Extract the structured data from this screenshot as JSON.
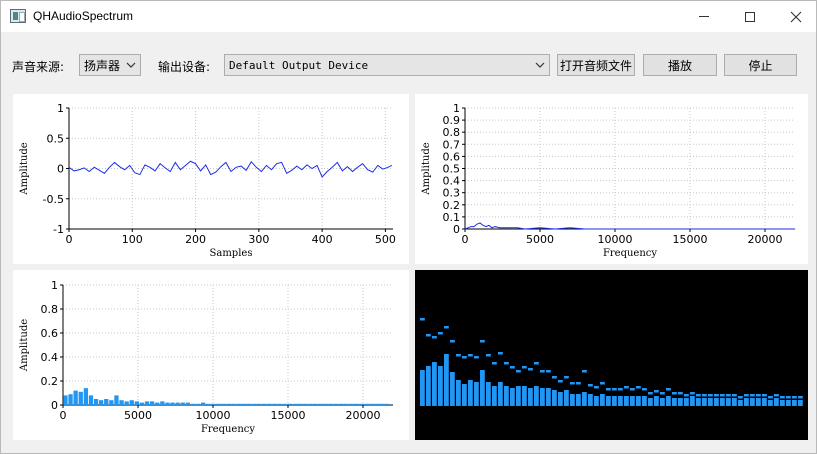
{
  "window": {
    "title": "QHAudioSpectrum",
    "controls": {
      "minimize": "minimize-icon",
      "maximize": "maximize-icon",
      "close": "close-icon"
    }
  },
  "toolbar": {
    "source_label": "声音来源:",
    "source_value": "扬声器",
    "output_label": "输出设备:",
    "output_value": "Default Output Device",
    "open_button": "打开音频文件",
    "play_button": "播放",
    "stop_button": "停止"
  },
  "colors": {
    "waveform": "#1f2ee6",
    "spectrum": "#1f2ee6",
    "bars": "#2196f3",
    "dark_bg": "#000000"
  },
  "chart_data": [
    {
      "type": "line",
      "xlabel": "Samples",
      "ylabel": "Amplitude",
      "xlim": [
        0,
        512
      ],
      "ylim": [
        -1,
        1
      ],
      "xticks": [
        "0",
        "100",
        "200",
        "300",
        "400",
        "500"
      ],
      "yticks": [
        "1",
        "0.5",
        "0",
        "-0.5",
        "-1"
      ],
      "grid": true,
      "x": [
        0,
        8,
        16,
        24,
        32,
        40,
        48,
        56,
        64,
        72,
        80,
        88,
        96,
        104,
        112,
        120,
        128,
        136,
        144,
        152,
        160,
        168,
        176,
        184,
        192,
        200,
        208,
        216,
        224,
        232,
        240,
        248,
        256,
        264,
        272,
        280,
        288,
        296,
        304,
        312,
        320,
        328,
        336,
        344,
        352,
        360,
        368,
        376,
        384,
        392,
        400,
        408,
        416,
        424,
        432,
        440,
        448,
        456,
        464,
        472,
        480,
        488,
        496,
        504,
        510
      ],
      "y": [
        0.02,
        -0.04,
        -0.02,
        0.01,
        -0.05,
        0.02,
        -0.03,
        -0.08,
        0.02,
        0.1,
        0.03,
        -0.02,
        0.05,
        -0.07,
        -0.1,
        0.06,
        0.02,
        -0.04,
        0.08,
        0.01,
        -0.05,
        0.1,
        -0.02,
        0.05,
        0.12,
        0.08,
        -0.04,
        0.06,
        -0.1,
        -0.06,
        0.03,
        0.1,
        -0.05,
        0.02,
        0.04,
        -0.03,
        0.11,
        0.02,
        -0.05,
        0.05,
        -0.02,
        0.08,
        0.1,
        -0.08,
        -0.03,
        0.04,
        -0.02,
        0.06,
        0.0,
        0.05,
        -0.14,
        -0.05,
        0.02,
        0.1,
        -0.04,
        0.03,
        -0.05,
        0.02,
        0.08,
        -0.02,
        -0.06,
        0.05,
        -0.01,
        0.02,
        0.05
      ]
    },
    {
      "type": "line",
      "xlabel": "Frequency",
      "ylabel": "Amplitude",
      "xlim": [
        0,
        22000
      ],
      "ylim": [
        0,
        1
      ],
      "xticks": [
        "0",
        "5000",
        "10000",
        "15000",
        "20000"
      ],
      "yticks": [
        "1",
        "0.9",
        "0.8",
        "0.7",
        "0.6",
        "0.5",
        "0.4",
        "0.3",
        "0.2",
        "0.1",
        "0"
      ],
      "grid": true,
      "x": [
        0,
        200,
        400,
        600,
        800,
        1000,
        1200,
        1400,
        1600,
        1800,
        2000,
        2300,
        2600,
        3000,
        3500,
        4000,
        5000,
        6000,
        7000,
        8000,
        10000,
        12000,
        15000,
        18000,
        22000
      ],
      "y": [
        0.0,
        0.01,
        0.02,
        0.02,
        0.04,
        0.05,
        0.03,
        0.02,
        0.03,
        0.01,
        0.02,
        0.01,
        0.01,
        0.01,
        0.01,
        0.0,
        0.01,
        0.0,
        0.01,
        0.0,
        0.0,
        0.0,
        0.0,
        0.0,
        0.0
      ]
    },
    {
      "type": "bar",
      "xlabel": "Frequency",
      "ylabel": "Amplitude",
      "xlim": [
        0,
        22000
      ],
      "ylim": [
        0,
        1
      ],
      "xticks": [
        "0",
        "5000",
        "10000",
        "15000",
        "20000"
      ],
      "yticks": [
        "1",
        "0.8",
        "0.6",
        "0.4",
        "0.2",
        "0"
      ],
      "grid": true,
      "bar_width": 340,
      "x": [
        170,
        510,
        850,
        1190,
        1530,
        1870,
        2210,
        2550,
        2890,
        3230,
        3570,
        3910,
        4250,
        4590,
        4930,
        5270,
        5610,
        5950,
        6290,
        6630,
        6970,
        7310,
        7650,
        7990,
        8330,
        8670,
        9010,
        9350,
        9690,
        10030,
        10370,
        10710,
        11050,
        11390,
        11730,
        12070,
        12410,
        12750,
        13090,
        13430,
        13770,
        14110,
        14450,
        14790,
        15130,
        15470,
        15810,
        16150,
        16490,
        16830,
        17170,
        17510,
        17850,
        18190,
        18530,
        18870,
        19210,
        19550,
        19890,
        20230,
        20570,
        20910,
        21250,
        21590
      ],
      "values": [
        0.08,
        0.09,
        0.12,
        0.11,
        0.14,
        0.08,
        0.05,
        0.04,
        0.05,
        0.04,
        0.08,
        0.04,
        0.03,
        0.04,
        0.03,
        0.02,
        0.03,
        0.03,
        0.02,
        0.03,
        0.02,
        0.02,
        0.02,
        0.02,
        0.02,
        0.01,
        0.01,
        0.02,
        0.01,
        0.01,
        0.01,
        0.01,
        0.01,
        0.01,
        0.01,
        0.01,
        0.01,
        0.01,
        0.01,
        0.01,
        0.01,
        0.01,
        0.01,
        0.01,
        0.01,
        0.01,
        0.01,
        0.01,
        0.01,
        0.01,
        0.01,
        0.01,
        0.01,
        0.01,
        0.01,
        0.01,
        0.01,
        0.01,
        0.01,
        0.01,
        0.01,
        0.01,
        0.01,
        0.01
      ]
    },
    {
      "type": "bar",
      "ylim": [
        0,
        1
      ],
      "values": [
        0.36,
        0.4,
        0.44,
        0.4,
        0.52,
        0.34,
        0.26,
        0.22,
        0.26,
        0.24,
        0.36,
        0.24,
        0.2,
        0.24,
        0.2,
        0.18,
        0.2,
        0.2,
        0.18,
        0.2,
        0.18,
        0.18,
        0.16,
        0.14,
        0.16,
        0.12,
        0.12,
        0.14,
        0.12,
        0.1,
        0.12,
        0.1,
        0.1,
        0.1,
        0.1,
        0.1,
        0.1,
        0.1,
        0.08,
        0.1,
        0.08,
        0.1,
        0.08,
        0.08,
        0.08,
        0.1,
        0.08,
        0.08,
        0.08,
        0.08,
        0.08,
        0.08,
        0.08,
        0.06,
        0.08,
        0.08,
        0.08,
        0.08,
        0.06,
        0.08,
        0.06,
        0.06,
        0.06,
        0.06
      ],
      "peaks": [
        0.88,
        0.72,
        0.7,
        0.74,
        0.8,
        0.66,
        0.52,
        0.5,
        0.52,
        0.5,
        0.66,
        0.52,
        0.44,
        0.54,
        0.44,
        0.4,
        0.36,
        0.4,
        0.38,
        0.44,
        0.36,
        0.36,
        0.3,
        0.26,
        0.3,
        0.24,
        0.24,
        0.36,
        0.22,
        0.2,
        0.24,
        0.18,
        0.18,
        0.18,
        0.2,
        0.18,
        0.2,
        0.18,
        0.14,
        0.16,
        0.14,
        0.18,
        0.14,
        0.14,
        0.12,
        0.14,
        0.12,
        0.12,
        0.12,
        0.12,
        0.12,
        0.12,
        0.12,
        0.1,
        0.12,
        0.12,
        0.12,
        0.12,
        0.1,
        0.12,
        0.1,
        0.1,
        0.1,
        0.1
      ]
    }
  ]
}
